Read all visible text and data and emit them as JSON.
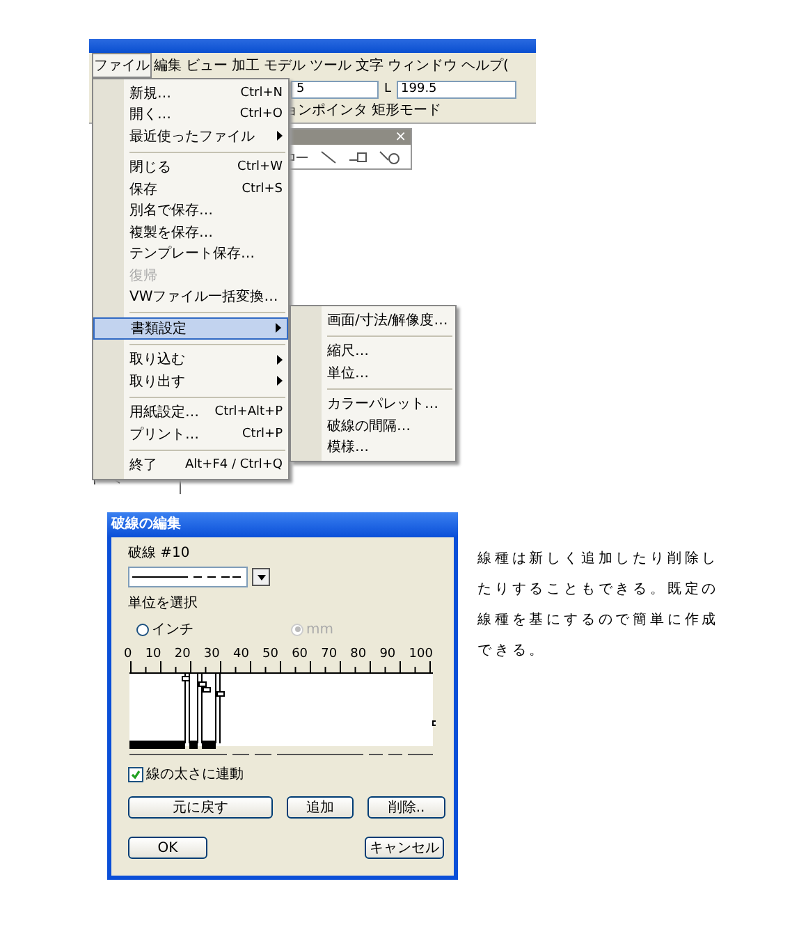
{
  "app": {
    "menubar": [
      {
        "label": "ファイル",
        "selected": true
      },
      {
        "label": "編集",
        "selected": false
      },
      {
        "label": "ビュー",
        "selected": false
      },
      {
        "label": "加工",
        "selected": false
      },
      {
        "label": "モデル",
        "selected": false
      },
      {
        "label": "ツール",
        "selected": false
      },
      {
        "label": "文字",
        "selected": false
      },
      {
        "label": "ウィンドウ",
        "selected": false
      },
      {
        "label": "ヘルプ(",
        "selected": false
      }
    ],
    "fields": [
      {
        "value": "5"
      },
      {
        "label": "L",
        "value": "199.5"
      }
    ],
    "mode_text": "ョンポインタ 矩形モード",
    "palette": {
      "close": "×"
    },
    "file_menu": [
      {
        "kind": "item",
        "label": "新規…",
        "shortcut": "Ctrl+N",
        "has_submenu": false,
        "disabled": false,
        "selected": false
      },
      {
        "kind": "item",
        "label": "開く…",
        "shortcut": "Ctrl+O",
        "has_submenu": false,
        "disabled": false,
        "selected": false
      },
      {
        "kind": "item",
        "label": "最近使ったファイル",
        "has_submenu": true,
        "disabled": false,
        "selected": false
      },
      {
        "kind": "separator"
      },
      {
        "kind": "item",
        "label": "閉じる",
        "shortcut": "Ctrl+W",
        "has_submenu": false,
        "disabled": false,
        "selected": false
      },
      {
        "kind": "item",
        "label": "保存",
        "shortcut": "Ctrl+S",
        "has_submenu": false,
        "disabled": false,
        "selected": false
      },
      {
        "kind": "item",
        "label": "別名で保存…",
        "has_submenu": false,
        "disabled": false,
        "selected": false
      },
      {
        "kind": "item",
        "label": "複製を保存…",
        "has_submenu": false,
        "disabled": false,
        "selected": false
      },
      {
        "kind": "item",
        "label": "テンプレート保存…",
        "has_submenu": false,
        "disabled": false,
        "selected": false
      },
      {
        "kind": "item",
        "label": "復帰",
        "has_submenu": false,
        "disabled": true,
        "selected": false
      },
      {
        "kind": "item",
        "label": "VWファイル一括変換…",
        "has_submenu": false,
        "disabled": false,
        "selected": false
      },
      {
        "kind": "separator"
      },
      {
        "kind": "item",
        "label": "書類設定",
        "has_submenu": true,
        "disabled": false,
        "selected": true
      },
      {
        "kind": "separator"
      },
      {
        "kind": "item",
        "label": "取り込む",
        "has_submenu": true,
        "disabled": false,
        "selected": false
      },
      {
        "kind": "item",
        "label": "取り出す",
        "has_submenu": true,
        "disabled": false,
        "selected": false
      },
      {
        "kind": "separator"
      },
      {
        "kind": "item",
        "label": "用紙設定…",
        "shortcut": "Ctrl+Alt+P",
        "has_submenu": false,
        "disabled": false,
        "selected": false
      },
      {
        "kind": "item",
        "label": "プリント…",
        "shortcut": "Ctrl+P",
        "has_submenu": false,
        "disabled": false,
        "selected": false
      },
      {
        "kind": "separator"
      },
      {
        "kind": "item",
        "label": "終了",
        "shortcut": "Alt+F4 / Ctrl+Q",
        "has_submenu": false,
        "disabled": false,
        "selected": false
      }
    ],
    "submenu": [
      {
        "kind": "item",
        "label": "画面/寸法/解像度…"
      },
      {
        "kind": "separator"
      },
      {
        "kind": "item",
        "label": "縮尺…"
      },
      {
        "kind": "item",
        "label": "単位…"
      },
      {
        "kind": "separator"
      },
      {
        "kind": "item",
        "label": "カラーパレット…"
      },
      {
        "kind": "item",
        "label": "破線の間隔…"
      },
      {
        "kind": "item",
        "label": "模様…"
      }
    ]
  },
  "dialog": {
    "title": "破線の編集",
    "dash_label": "破線 #10",
    "unit_label": "単位を選択",
    "units": [
      {
        "label": "インチ",
        "selected": false,
        "disabled": false
      },
      {
        "label": "mm",
        "selected": true,
        "disabled": true
      }
    ],
    "ruler_labels": [
      "0",
      "10",
      "20",
      "30",
      "40",
      "50",
      "60",
      "70",
      "80",
      "90",
      "100"
    ],
    "link_checkbox": {
      "label": "線の太さに連動",
      "checked": true
    },
    "buttons": [
      "元に戻す",
      "追加",
      "削除.."
    ],
    "footer_buttons": [
      "OK",
      "キャンセル"
    ]
  },
  "note": "線種は新しく追加したり削除したりすることもできる。既定の線種を基にするので簡単に作成できる。"
}
